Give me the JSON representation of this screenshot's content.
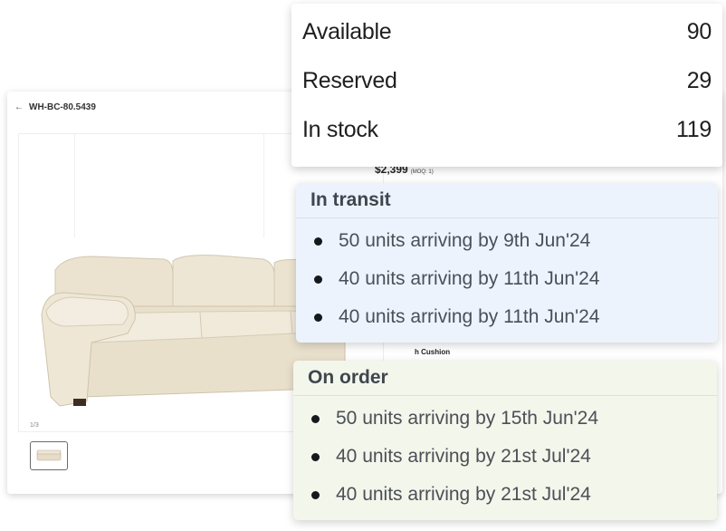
{
  "product": {
    "back_icon": "arrow-left-icon",
    "sku": "WH-BC-80.5439",
    "price": "$2,399",
    "price_note": "(MOQ: 1)",
    "image_counter": "1/3",
    "detail_snippet": "h Cushion"
  },
  "stock": {
    "rows": [
      {
        "label": "Available",
        "value": "90"
      },
      {
        "label": "Reserved",
        "value": "29"
      },
      {
        "label": "In stock",
        "value": "119"
      }
    ]
  },
  "in_transit": {
    "title": "In transit",
    "items": [
      "50 units arriving by 9th Jun'24",
      "40 units arriving by 11th Jun'24",
      "40 units arriving by 11th Jun'24"
    ]
  },
  "on_order": {
    "title": "On order",
    "items": [
      "50 units arriving by 15th Jun'24",
      "40 units arriving by 21st Jul'24",
      "40 units arriving by 21st Jul'24"
    ]
  },
  "colors": {
    "transit_bg": "#edf3fd",
    "order_bg": "#f3f6ea",
    "sofa": "#ece4d2"
  }
}
